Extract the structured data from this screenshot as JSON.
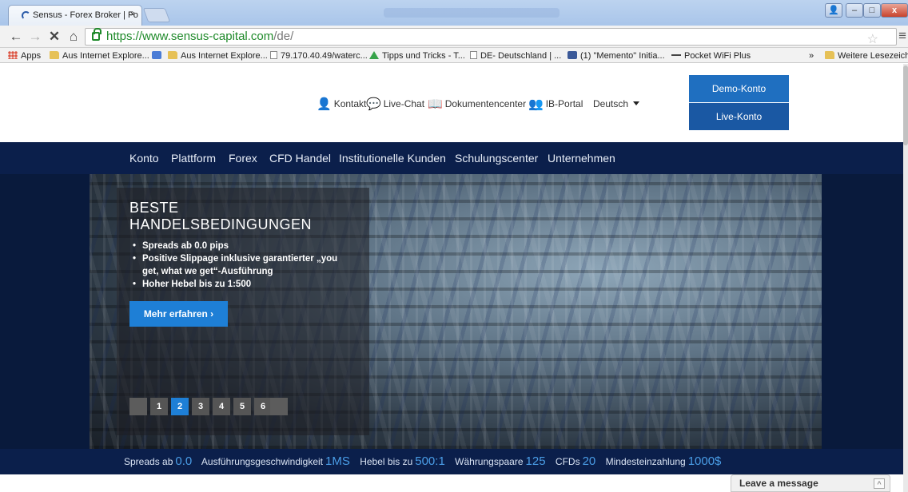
{
  "browser": {
    "tab_title": "Sensus - Forex Broker | Fo",
    "tab_close": "×",
    "url_scheme_host": "https://www.sensus-capital.com",
    "url_path": "/de/",
    "back": "←",
    "forward": "→",
    "stop": "✕",
    "home": "⌂",
    "star": "☆",
    "menu": "≡",
    "window": {
      "user": "👤",
      "minimize": "–",
      "maximize": "□",
      "close": "x"
    },
    "bookmarks": [
      {
        "label": "Apps",
        "icon": "apps-icon"
      },
      {
        "label": "Aus Internet Explore...",
        "icon": "folder-icon"
      },
      {
        "label": "",
        "icon": "google-icon"
      },
      {
        "label": "Aus Internet Explore...",
        "icon": "folder-icon"
      },
      {
        "label": "79.170.40.49/waterc...",
        "icon": "page-icon"
      },
      {
        "label": "Tipps und Tricks - T...",
        "icon": "triangle-icon"
      },
      {
        "label": "DE- Deutschland | ...",
        "icon": "page-icon"
      },
      {
        "label": "(1) \"Memento\" Initia...",
        "icon": "facebook-icon"
      },
      {
        "label": "Pocket WiFi Plus",
        "icon": "dash-icon"
      }
    ],
    "bookmarks_overflow": "»",
    "bookmarks_other": "Weitere Lesezeichen"
  },
  "header": {
    "links": [
      {
        "label": "Kontakt",
        "icon": "person-icon",
        "glyph": "👤"
      },
      {
        "label": "Live-Chat",
        "icon": "chat-icon",
        "glyph": "💬"
      },
      {
        "label": "Dokumentencenter",
        "icon": "book-icon",
        "glyph": "📖"
      },
      {
        "label": "IB-Portal",
        "icon": "group-icon",
        "glyph": "👥"
      }
    ],
    "language": "Deutsch",
    "demo_button": "Demo-Konto",
    "live_button": "Live-Konto"
  },
  "nav": {
    "items": [
      "Konto",
      "Plattform",
      "Forex",
      "CFD Handel",
      "Institutionelle Kunden",
      "Schulungscenter",
      "Unternehmen"
    ]
  },
  "hero": {
    "title_line1": "BESTE",
    "title_line2": "HANDELSBEDINGUNGEN",
    "bullets": [
      "Spreads ab 0.0 pips",
      "Positive Slippage inklusive garantierter „you get, what we get“-Ausführung",
      "Hoher Hebel bis zu 1:500"
    ],
    "cta": "Mehr erfahren ›",
    "pager": [
      "1",
      "2",
      "3",
      "4",
      "5",
      "6"
    ],
    "active_page": "2"
  },
  "stats": [
    {
      "label": "Spreads ab",
      "value": "0.0"
    },
    {
      "label": "Ausführungsgeschwindigkeit",
      "value": "1MS"
    },
    {
      "label": "Hebel bis zu",
      "value": "500:1"
    },
    {
      "label": "Währungspaare",
      "value": "125"
    },
    {
      "label": "CFDs",
      "value": "20"
    },
    {
      "label": "Mindesteinzahlung",
      "value": "1000$"
    }
  ],
  "chat_widget": {
    "label": "Leave a message",
    "chevron": "^"
  },
  "colors": {
    "brand_blue": "#1e5fae",
    "nav_bg": "#0b1f4b",
    "accent": "#1e7fd6",
    "stat_value": "#4a9de6"
  }
}
